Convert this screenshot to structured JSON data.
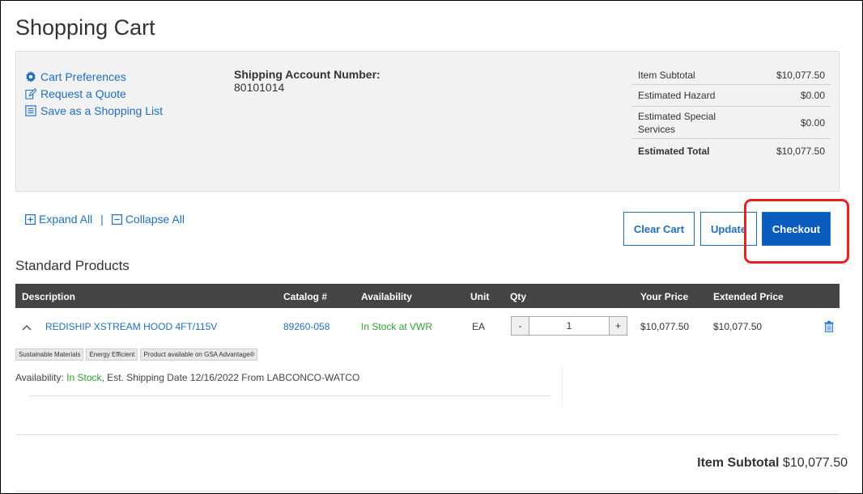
{
  "page": {
    "title": "Shopping Cart"
  },
  "links": {
    "cart_preferences": "Cart Preferences",
    "request_quote": "Request a Quote",
    "save_list": "Save as a Shopping List"
  },
  "shipping": {
    "label": "Shipping Account Number:",
    "value": "80101014"
  },
  "summary": [
    {
      "label": "Item Subtotal",
      "value": "$10,077.50"
    },
    {
      "label": "Estimated Hazard",
      "value": "$0.00"
    },
    {
      "label": "Estimated Special Services",
      "value": "$0.00"
    },
    {
      "label": "Estimated Total",
      "value": "$10,077.50"
    }
  ],
  "controls": {
    "expand_all": "Expand All",
    "separator": "|",
    "collapse_all": "Collapse All"
  },
  "buttons": {
    "clear_cart": "Clear Cart",
    "update": "Update",
    "checkout": "Checkout"
  },
  "section": {
    "title": "Standard Products"
  },
  "table": {
    "headers": [
      "Description",
      "Catalog #",
      "Availability",
      "Unit",
      "Qty",
      "Your Price",
      "Extended Price"
    ]
  },
  "item": {
    "name": "REDISHIP XSTREAM HOOD 4FT/115V",
    "catalog": "89260-058",
    "availability": "In Stock at VWR",
    "unit": "EA",
    "qty": "1",
    "qty_minus": "-",
    "qty_plus": "+",
    "your_price": "$10,077.50",
    "extended_price": "$10,077.50",
    "tags": [
      "Sustainable Materials",
      "Energy Efficient",
      "Product available on GSA Advantage®"
    ],
    "avail_label": "Availability:",
    "avail_status": "In Stock",
    "ship_text": ", Est. Shipping Date 12/16/2022 From LABCONCO-WATCO"
  },
  "footer": {
    "subtotal_label": "Item Subtotal",
    "subtotal_value": "$10,077.50"
  },
  "colors": {
    "link": "#1f6fbf",
    "primary_button": "#0b5cbf",
    "highlight": "#e52323",
    "in_stock": "#2e9d2e",
    "header_bg": "#444444"
  }
}
